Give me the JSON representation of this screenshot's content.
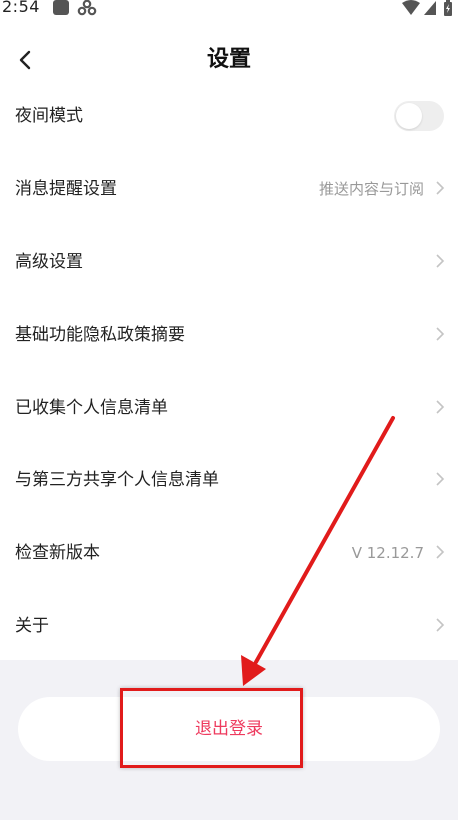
{
  "status_bar": {
    "time": "2:54"
  },
  "header": {
    "title": "设置"
  },
  "settings": [
    {
      "label": "夜间模式",
      "control": "toggle",
      "toggle_on": false
    },
    {
      "label": "消息提醒设置",
      "value": "推送内容与订阅",
      "control": "chevron"
    },
    {
      "label": "高级设置",
      "control": "chevron"
    },
    {
      "label": "基础功能隐私政策摘要",
      "control": "chevron"
    },
    {
      "label": "已收集个人信息清单",
      "control": "chevron"
    },
    {
      "label": "与第三方共享个人信息清单",
      "control": "chevron"
    },
    {
      "label": "检查新版本",
      "value": "V 12.12.7",
      "control": "chevron"
    },
    {
      "label": "关于",
      "control": "chevron"
    }
  ],
  "logout": {
    "label": "退出登录"
  },
  "colors": {
    "accent_text": "#ee3a5e",
    "annotation_red": "#e11b1b",
    "bottom_background": "#f2f2f6",
    "toggle_off": "#eeeeee"
  }
}
